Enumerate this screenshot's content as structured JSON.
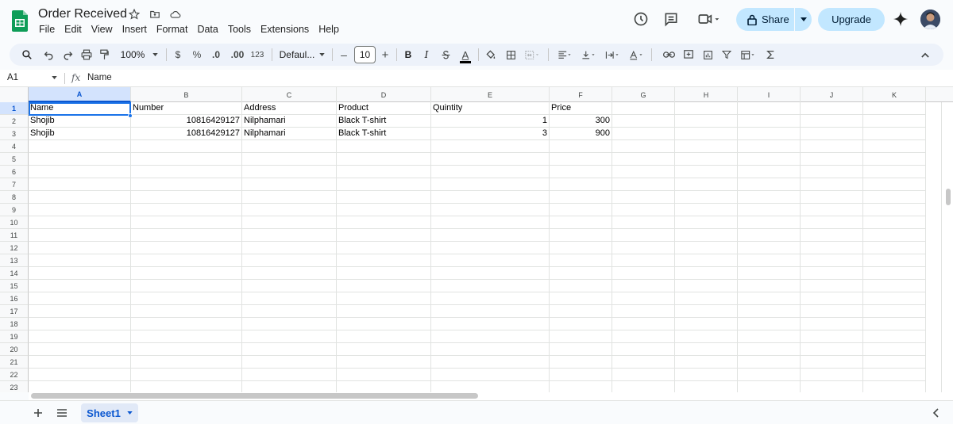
{
  "header": {
    "title": "Order Received",
    "menu": [
      "File",
      "Edit",
      "View",
      "Insert",
      "Format",
      "Data",
      "Tools",
      "Extensions",
      "Help"
    ],
    "share_label": "Share",
    "upgrade_label": "Upgrade"
  },
  "toolbar": {
    "zoom": "100%",
    "currency": "$",
    "percent": "%",
    "decimal_decrease": ".0",
    "decimal_increase": ".00",
    "number_format": "123",
    "font": "Defaul...",
    "font_size": "10",
    "bold": "B",
    "italic": "I",
    "text_color": "A",
    "minus": "–",
    "plus": "+"
  },
  "formula_bar": {
    "cell_ref": "A1",
    "fx": "fx",
    "content": "Name"
  },
  "grid": {
    "columns": [
      "A",
      "B",
      "C",
      "D",
      "E",
      "F",
      "G",
      "H",
      "I",
      "J",
      "K"
    ],
    "rows": [
      "1",
      "2",
      "3",
      "4",
      "5",
      "6",
      "7",
      "8",
      "9",
      "10",
      "11",
      "12",
      "13",
      "14",
      "15",
      "16",
      "17",
      "18",
      "19",
      "20",
      "21",
      "22",
      "23"
    ],
    "cells": [
      [
        "Name",
        "Number",
        "Address",
        "Product",
        "Quintity",
        "Price"
      ],
      [
        "Shojib",
        "10816429127",
        "Nilphamari",
        "Black T-shirt",
        "1",
        "300"
      ],
      [
        "Shojib",
        "10816429127",
        "Nilphamari",
        "Black T-shirt",
        "3",
        "900"
      ]
    ]
  },
  "sheets": {
    "active": "Sheet1"
  },
  "colors": {
    "accent": "#1a73e8",
    "share_bg": "#c2e7ff",
    "sheets_green": "#0f9d58"
  }
}
